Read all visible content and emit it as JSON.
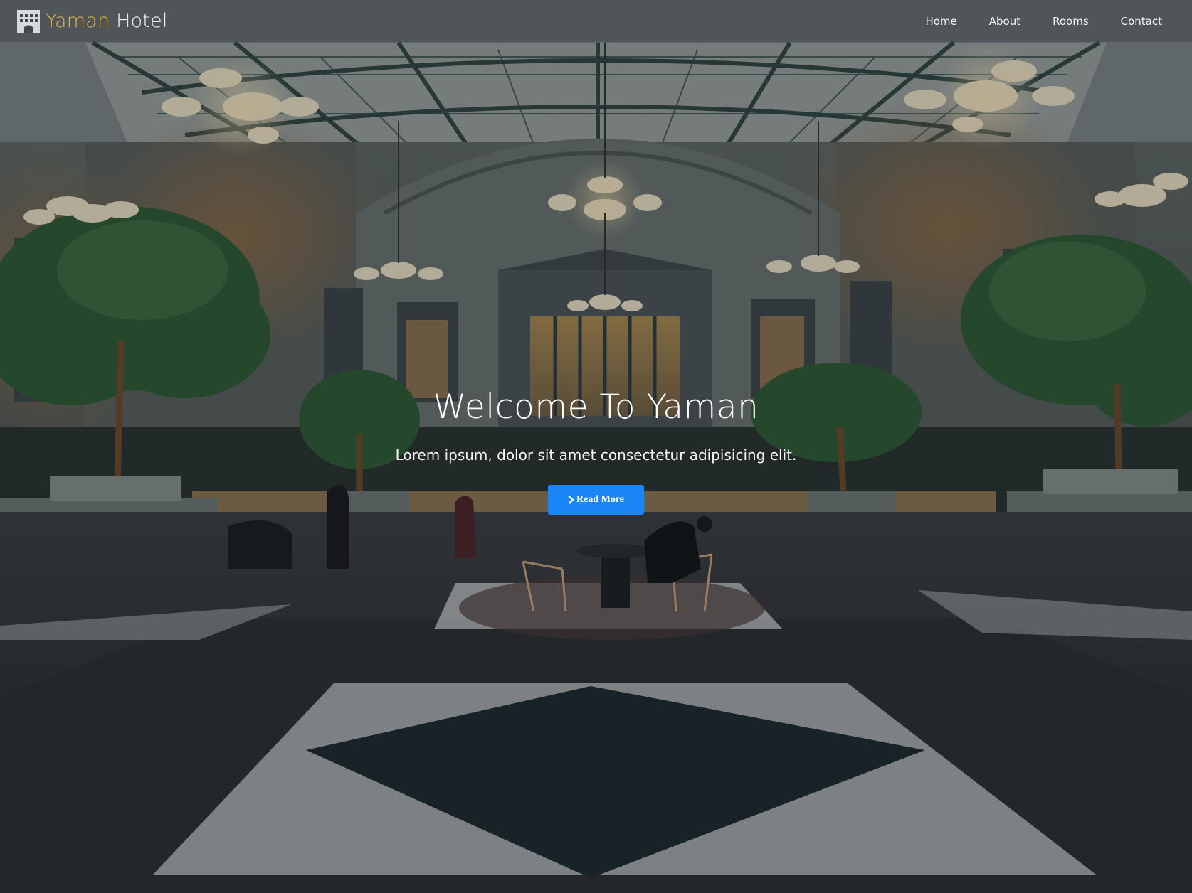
{
  "brand": {
    "name_first": "Yaman",
    "name_second": "Hotel",
    "icon": "hotel-building-icon",
    "accent_color": "#e8b33a"
  },
  "nav": {
    "items": [
      {
        "label": "Home"
      },
      {
        "label": "About"
      },
      {
        "label": "Rooms"
      },
      {
        "label": "Contact"
      }
    ]
  },
  "hero": {
    "title": "Welcome To Yaman",
    "subtitle": "Lorem ipsum, dolor sit amet consectetur adipisicing elit.",
    "button_label": "Read More",
    "button_icon": "chevron-right-icon",
    "button_color": "#1a86f5",
    "background": "hotel-atrium-photo"
  }
}
